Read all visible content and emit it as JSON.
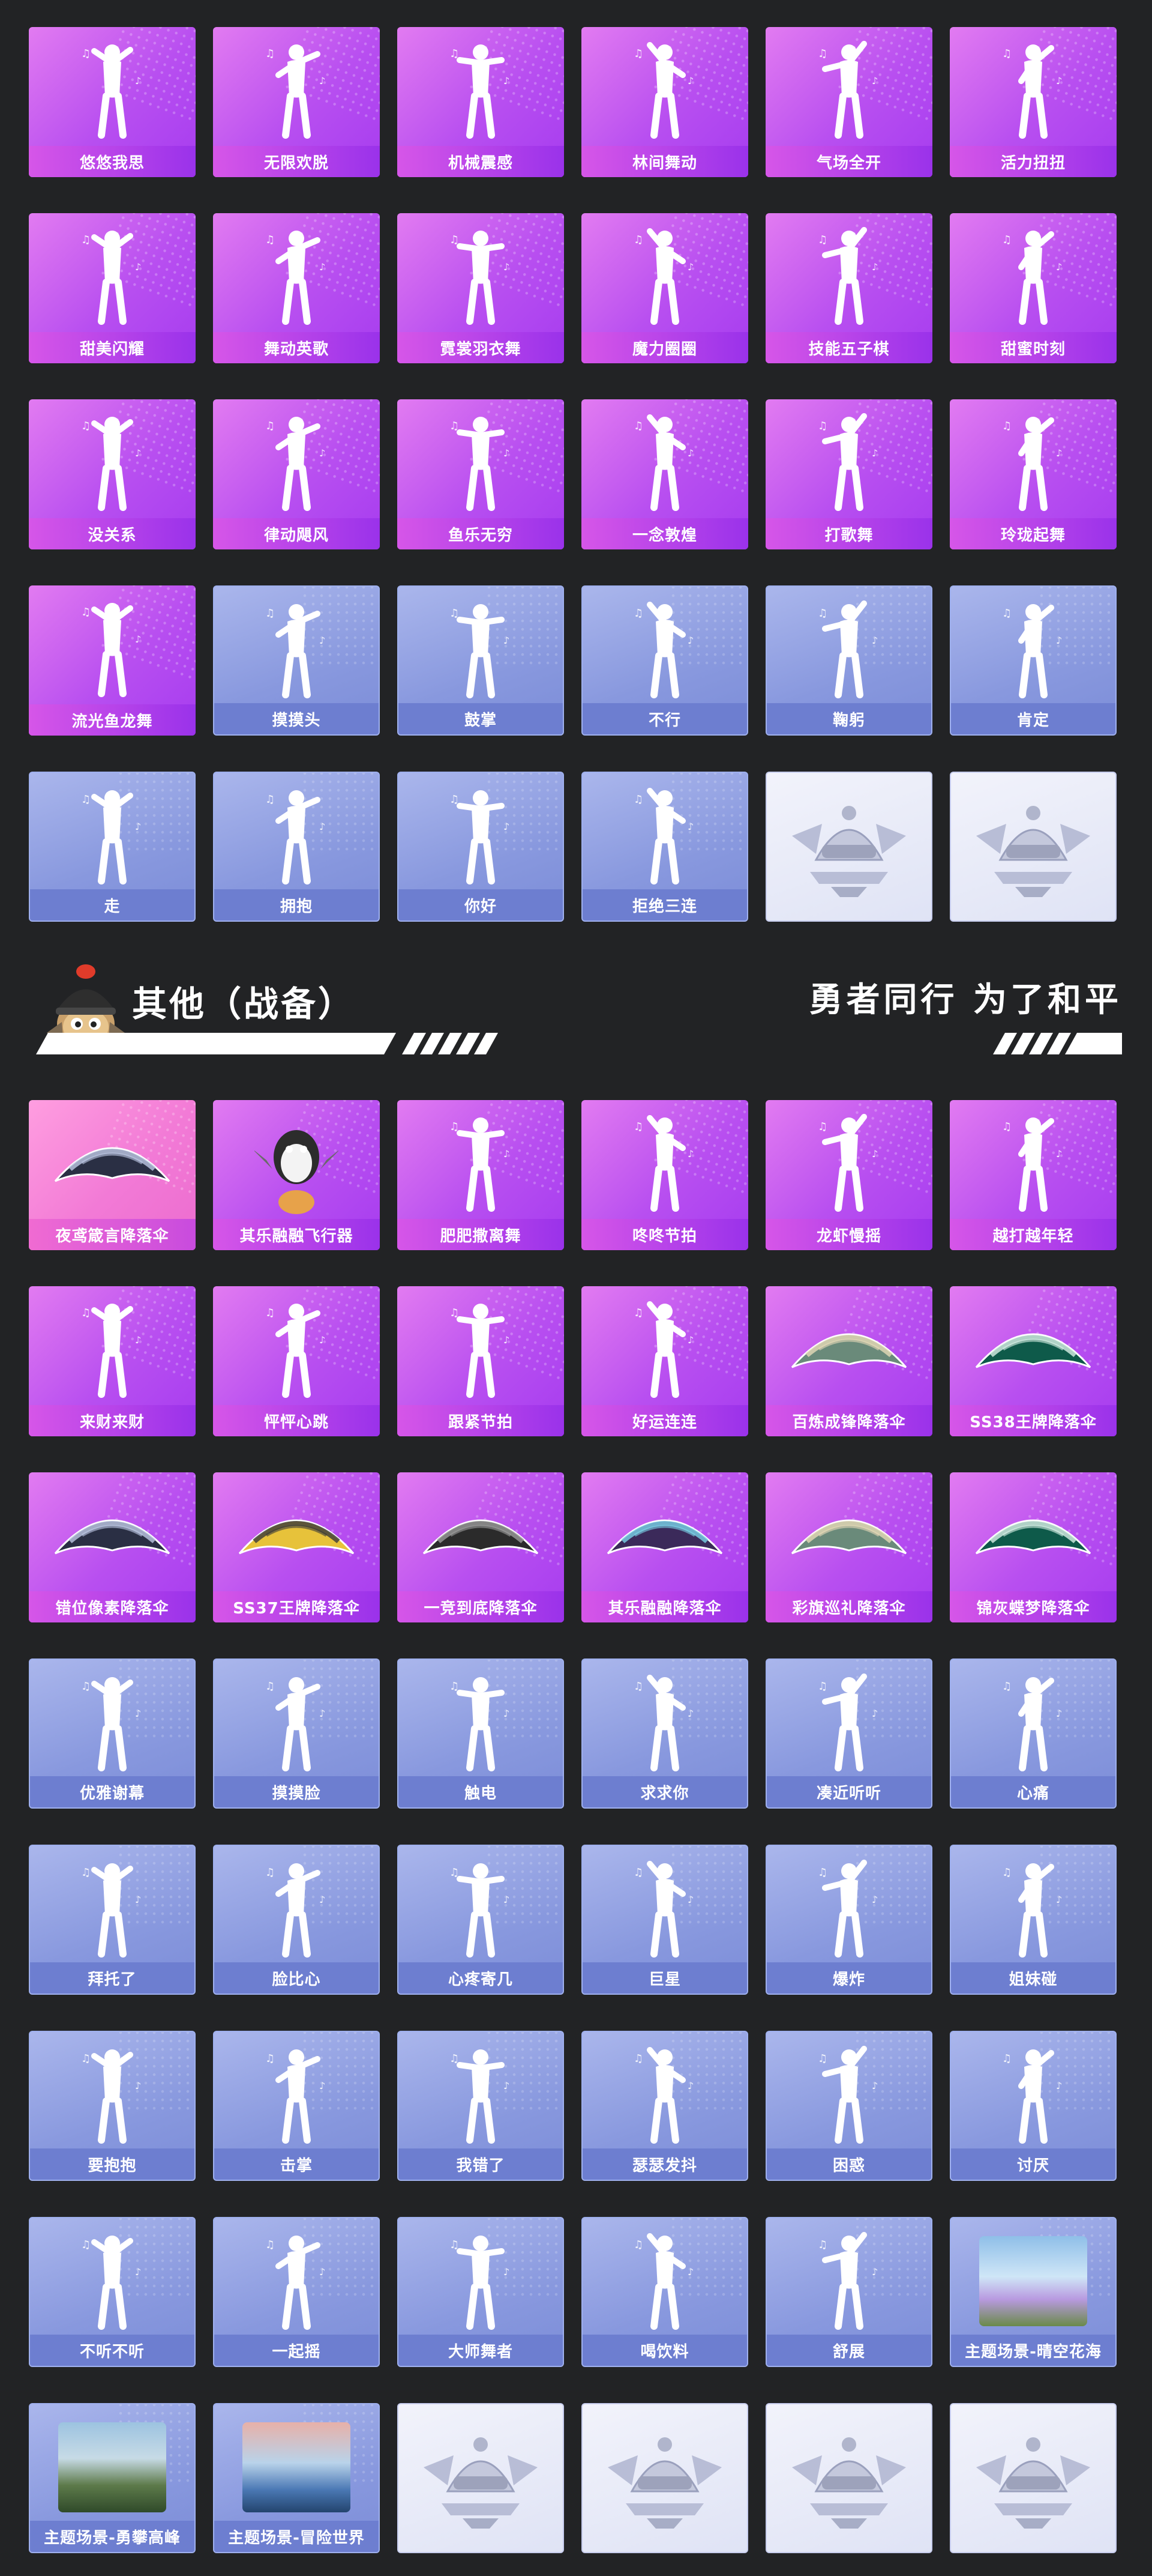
{
  "section_top": {
    "rows": [
      [
        {
          "label": "悠悠我思",
          "style": "purple",
          "icon": "dancer-icon"
        },
        {
          "label": "无限欢脱",
          "style": "purple",
          "icon": "dancer-icon"
        },
        {
          "label": "机械震感",
          "style": "purple",
          "icon": "dancer-icon"
        },
        {
          "label": "林间舞动",
          "style": "purple",
          "icon": "dancer-icon"
        },
        {
          "label": "气场全开",
          "style": "purple",
          "icon": "dancer-icon"
        },
        {
          "label": "活力扭扭",
          "style": "purple",
          "icon": "dancer-icon"
        }
      ],
      [
        {
          "label": "甜美闪耀",
          "style": "purple",
          "icon": "dancer-icon"
        },
        {
          "label": "舞动英歌",
          "style": "purple",
          "icon": "bubble-dancer-icon"
        },
        {
          "label": "霓裳羽衣舞",
          "style": "purple",
          "icon": "dancer-icon"
        },
        {
          "label": "魔力圈圈",
          "style": "purple",
          "icon": "dancer-icon"
        },
        {
          "label": "技能五子棋",
          "style": "purple",
          "icon": "dancer-icon"
        },
        {
          "label": "甜蜜时刻",
          "style": "purple",
          "icon": "dancer-icon"
        }
      ],
      [
        {
          "label": "没关系",
          "style": "purple",
          "icon": "dancer-icon"
        },
        {
          "label": "律动飓风",
          "style": "purple",
          "icon": "dancer-icon"
        },
        {
          "label": "鱼乐无穷",
          "style": "purple",
          "icon": "fish-dancer-icon"
        },
        {
          "label": "一念敦煌",
          "style": "purple",
          "icon": "dancer-icon"
        },
        {
          "label": "打歌舞",
          "style": "purple",
          "icon": "dancer-icon"
        },
        {
          "label": "玲珑起舞",
          "style": "purple",
          "icon": "dancer-icon"
        }
      ],
      [
        {
          "label": "流光鱼龙舞",
          "style": "purple",
          "icon": "dragon-dancer-icon"
        },
        {
          "label": "摸摸头",
          "style": "blue",
          "icon": "pat-head-icon"
        },
        {
          "label": "鼓掌",
          "style": "blue",
          "icon": "clap-icon"
        },
        {
          "label": "不行",
          "style": "blue",
          "icon": "head-shake-icon"
        },
        {
          "label": "鞠躬",
          "style": "blue",
          "icon": "bow-icon"
        },
        {
          "label": "肯定",
          "style": "blue",
          "icon": "nod-icon"
        }
      ],
      [
        {
          "label": "走",
          "style": "blue",
          "icon": "point-hand-icon"
        },
        {
          "label": "拥抱",
          "style": "blue",
          "icon": "hug-icon"
        },
        {
          "label": "你好",
          "style": "blue",
          "icon": "wave-icon"
        },
        {
          "label": "拒绝三连",
          "style": "blue",
          "icon": "refuse-icon"
        },
        {
          "label": "",
          "style": "pale",
          "icon": "helmet-emblem-icon"
        },
        {
          "label": "",
          "style": "pale",
          "icon": "helmet-emblem-icon"
        }
      ]
    ]
  },
  "section_other": {
    "title": "其他（战备）",
    "slogan": "勇者同行 为了和平",
    "mascot_icon": "helmet-chick-mascot-icon",
    "rows": [
      [
        {
          "label": "夜鸢箴言降落伞",
          "style": "pink",
          "icon": "parachute-icon"
        },
        {
          "label": "其乐融融飞行器",
          "style": "purple",
          "icon": "penguin-glider-icon"
        },
        {
          "label": "肥肥撒离舞",
          "style": "purple",
          "icon": "dancer-icon"
        },
        {
          "label": "咚咚节拍",
          "style": "purple",
          "icon": "dancer-icon"
        },
        {
          "label": "龙虾慢摇",
          "style": "purple",
          "icon": "dancer-icon"
        },
        {
          "label": "越打越年轻",
          "style": "purple",
          "icon": "dancer-icon"
        }
      ],
      [
        {
          "label": "来财来财",
          "style": "purple",
          "icon": "fortune-dancer-icon"
        },
        {
          "label": "怦怦心跳",
          "style": "purple",
          "icon": "dancer-icon"
        },
        {
          "label": "跟紧节拍",
          "style": "purple",
          "icon": "dancer-icon"
        },
        {
          "label": "好运连连",
          "style": "purple",
          "icon": "dancer-icon"
        },
        {
          "label": "百炼成锋降落伞",
          "style": "purple",
          "icon": "parachute-icon"
        },
        {
          "label": "SS38王牌降落伞",
          "style": "purple",
          "icon": "parachute-icon"
        }
      ],
      [
        {
          "label": "错位像素降落伞",
          "style": "purple",
          "icon": "parachute-icon"
        },
        {
          "label": "SS37王牌降落伞",
          "style": "purple",
          "icon": "parachute-icon"
        },
        {
          "label": "一竞到底降落伞",
          "style": "purple",
          "icon": "parachute-icon"
        },
        {
          "label": "其乐融融降落伞",
          "style": "purple",
          "icon": "parachute-icon"
        },
        {
          "label": "彩旗巡礼降落伞",
          "style": "purple",
          "icon": "parachute-icon"
        },
        {
          "label": "锦灰蝶梦降落伞",
          "style": "purple",
          "icon": "parachute-icon"
        }
      ],
      [
        {
          "label": "优雅谢幕",
          "style": "blue",
          "icon": "dancer-icon"
        },
        {
          "label": "摸摸脸",
          "style": "blue",
          "icon": "dancer-icon"
        },
        {
          "label": "触电",
          "style": "blue",
          "icon": "dancer-icon"
        },
        {
          "label": "求求你",
          "style": "blue",
          "icon": "dancer-icon"
        },
        {
          "label": "凑近听听",
          "style": "blue",
          "icon": "dancer-icon"
        },
        {
          "label": "心痛",
          "style": "blue",
          "icon": "dancer-icon"
        }
      ],
      [
        {
          "label": "拜托了",
          "style": "blue",
          "icon": "dancer-icon"
        },
        {
          "label": "脸比心",
          "style": "blue",
          "icon": "dancer-icon"
        },
        {
          "label": "心疼寄几",
          "style": "blue",
          "icon": "dancer-icon"
        },
        {
          "label": "巨星",
          "style": "blue",
          "icon": "dancer-icon"
        },
        {
          "label": "爆炸",
          "style": "blue",
          "icon": "dancer-icon"
        },
        {
          "label": "姐妹碰",
          "style": "blue",
          "icon": "dancer-icon"
        }
      ],
      [
        {
          "label": "要抱抱",
          "style": "blue",
          "icon": "dancer-icon"
        },
        {
          "label": "击掌",
          "style": "blue",
          "icon": "dancer-icon"
        },
        {
          "label": "我错了",
          "style": "blue",
          "icon": "dancer-icon"
        },
        {
          "label": "瑟瑟发抖",
          "style": "blue",
          "icon": "dancer-icon"
        },
        {
          "label": "困惑",
          "style": "blue",
          "icon": "dancer-icon"
        },
        {
          "label": "讨厌",
          "style": "blue",
          "icon": "dancer-icon"
        }
      ],
      [
        {
          "label": "不听不听",
          "style": "blue",
          "icon": "dancer-icon"
        },
        {
          "label": "一起摇",
          "style": "blue",
          "icon": "dancer-icon"
        },
        {
          "label": "大师舞者",
          "style": "blue",
          "icon": "dancer-icon"
        },
        {
          "label": "喝饮料",
          "style": "blue",
          "icon": "dancer-icon"
        },
        {
          "label": "舒展",
          "style": "blue",
          "icon": "dancer-icon"
        },
        {
          "label": "主题场景-晴空花海",
          "style": "blue",
          "icon": "landscape-flowers-icon"
        }
      ],
      [
        {
          "label": "主题场景-勇攀高峰",
          "style": "blue",
          "icon": "landscape-mountain-icon"
        },
        {
          "label": "主题场景-冒险世界",
          "style": "blue",
          "icon": "landscape-sea-icon"
        },
        {
          "label": "",
          "style": "pale",
          "icon": "helmet-emblem-icon"
        },
        {
          "label": "",
          "style": "pale",
          "icon": "helmet-emblem-icon"
        },
        {
          "label": "",
          "style": "pale",
          "icon": "helmet-emblem-icon"
        },
        {
          "label": "",
          "style": "pale",
          "icon": "helmet-emblem-icon"
        }
      ]
    ]
  }
}
